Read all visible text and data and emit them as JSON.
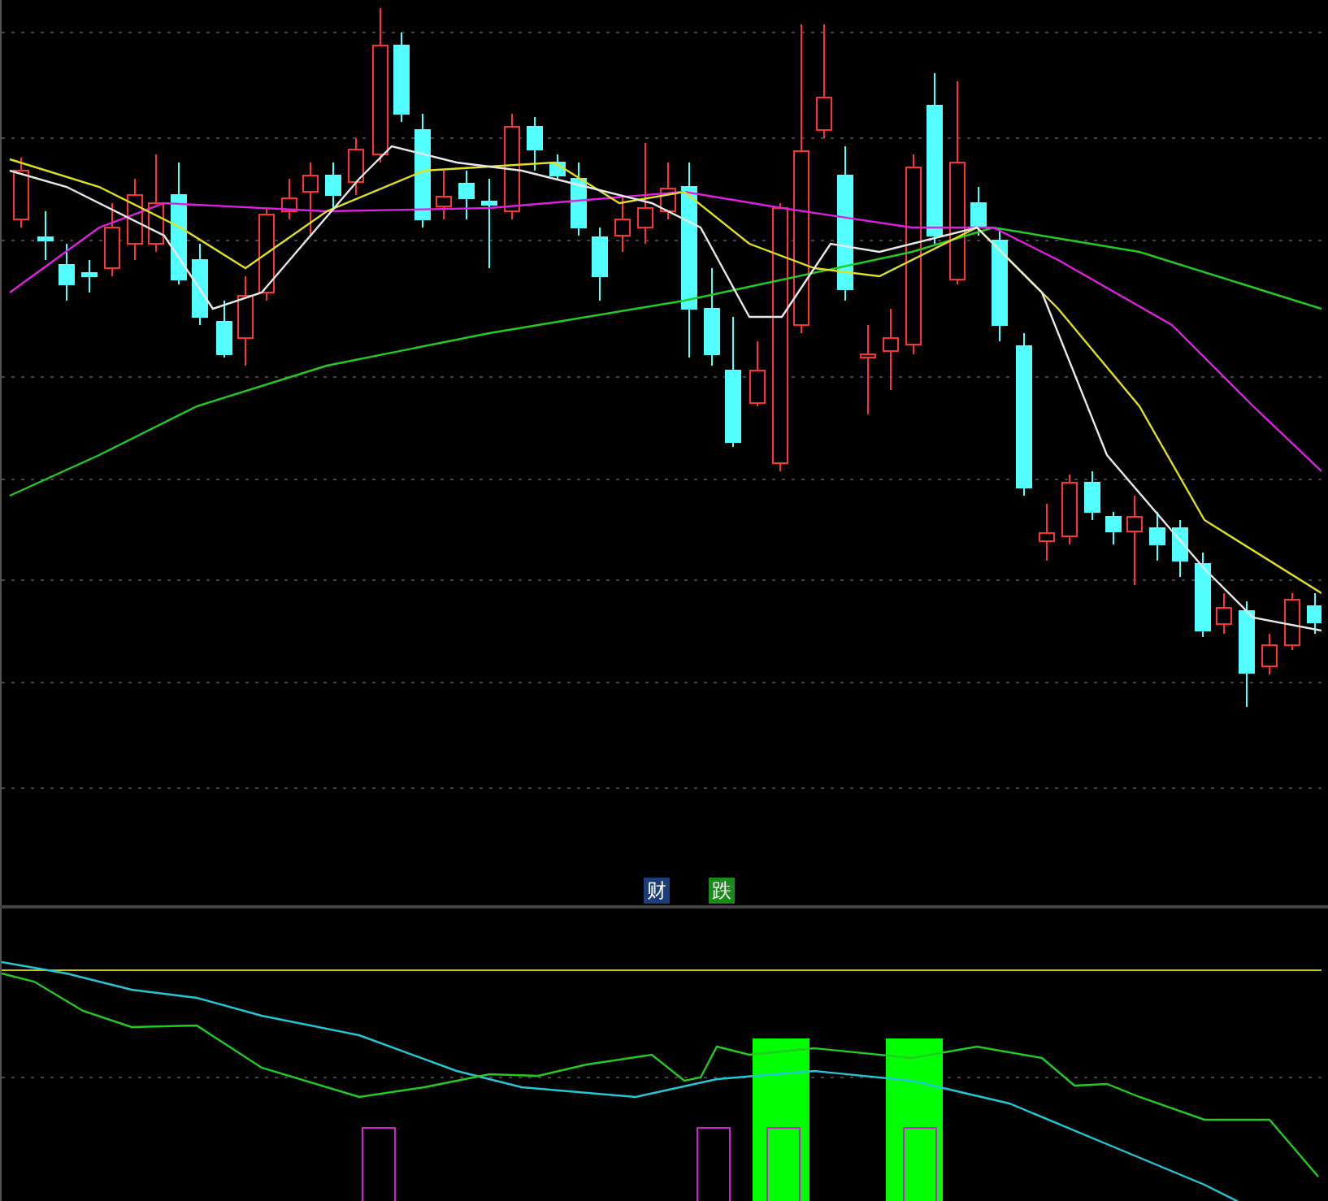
{
  "badges": [
    {
      "label": "财",
      "kind": "finance"
    },
    {
      "label": "跌",
      "kind": "fall"
    }
  ]
}
